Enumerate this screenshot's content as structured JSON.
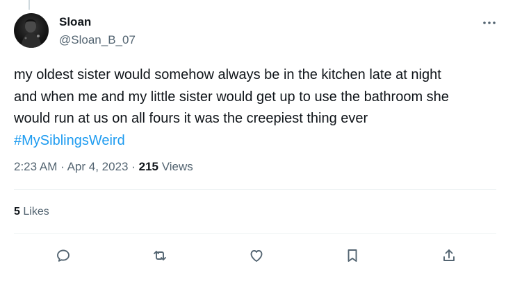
{
  "user": {
    "display_name": "Sloan",
    "handle": "@Sloan_B_07"
  },
  "tweet": {
    "text_lines": [
      "my oldest sister would somehow always be in the kitchen late at night",
      "and when me and my little sister would get up to use the bathroom she",
      "would run at us on all fours it was the creepiest thing ever"
    ],
    "hashtag": "#MySiblingsWeird",
    "time": "2:23 AM",
    "separator": "·",
    "date": "Apr 4, 2023",
    "views_count": "215",
    "views_label": "Views"
  },
  "engagement": {
    "likes_count": "5",
    "likes_label": "Likes"
  },
  "actions": [
    {
      "icon": "reply-icon"
    },
    {
      "icon": "retweet-icon"
    },
    {
      "icon": "like-icon"
    },
    {
      "icon": "bookmark-icon"
    },
    {
      "icon": "share-icon"
    }
  ],
  "more_menu_icon": "more-icon",
  "colors": {
    "text": "#0f1419",
    "secondary": "#536471",
    "hashtag": "#1d9bf0",
    "divider": "#eff3f4"
  }
}
